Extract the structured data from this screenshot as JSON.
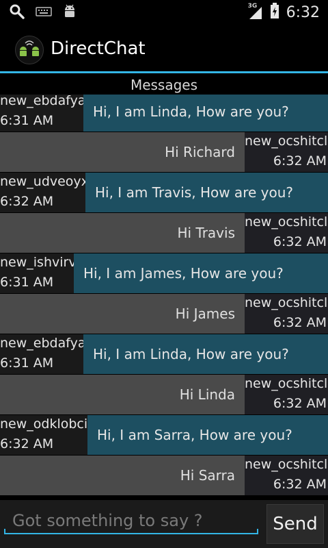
{
  "status_bar": {
    "time": "6:32",
    "network": "3G",
    "icons": [
      "search-icon",
      "keyboard-icon",
      "android-icon",
      "signal-icon",
      "battery-icon"
    ]
  },
  "app": {
    "title": "DirectChat",
    "accent": "#33b5e5"
  },
  "header": {
    "label": "Messages"
  },
  "messages": [
    {
      "dir": "in",
      "name": "new_ebdafya",
      "time": "6:31 AM",
      "text": "Hi, I am Linda, How are you?"
    },
    {
      "dir": "out",
      "name": "new_ocshitcl",
      "time": "6:32 AM",
      "text": "Hi Richard"
    },
    {
      "dir": "in",
      "name": "new_udveoyx",
      "time": "6:32 AM",
      "text": "Hi, I am Travis, How are you?"
    },
    {
      "dir": "out",
      "name": "new_ocshitcl",
      "time": "6:32 AM",
      "text": "Hi Travis"
    },
    {
      "dir": "in",
      "name": "new_ishvirv",
      "time": "6:31 AM",
      "text": "Hi, I am James, How are you?"
    },
    {
      "dir": "out",
      "name": "new_ocshitcl",
      "time": "6:32 AM",
      "text": "Hi James"
    },
    {
      "dir": "in",
      "name": "new_ebdafya",
      "time": "6:31 AM",
      "text": "Hi, I am Linda, How are you?"
    },
    {
      "dir": "out",
      "name": "new_ocshitcl",
      "time": "6:32 AM",
      "text": "Hi Linda"
    },
    {
      "dir": "in",
      "name": "new_odklobci",
      "time": "6:32 AM",
      "text": "Hi, I am Sarra, How are you?"
    },
    {
      "dir": "out",
      "name": "new_ocshitcl",
      "time": "6:32 AM",
      "text": "Hi Sarra"
    }
  ],
  "composer": {
    "placeholder": "Got something to say ?",
    "value": "",
    "send_label": "Send"
  }
}
